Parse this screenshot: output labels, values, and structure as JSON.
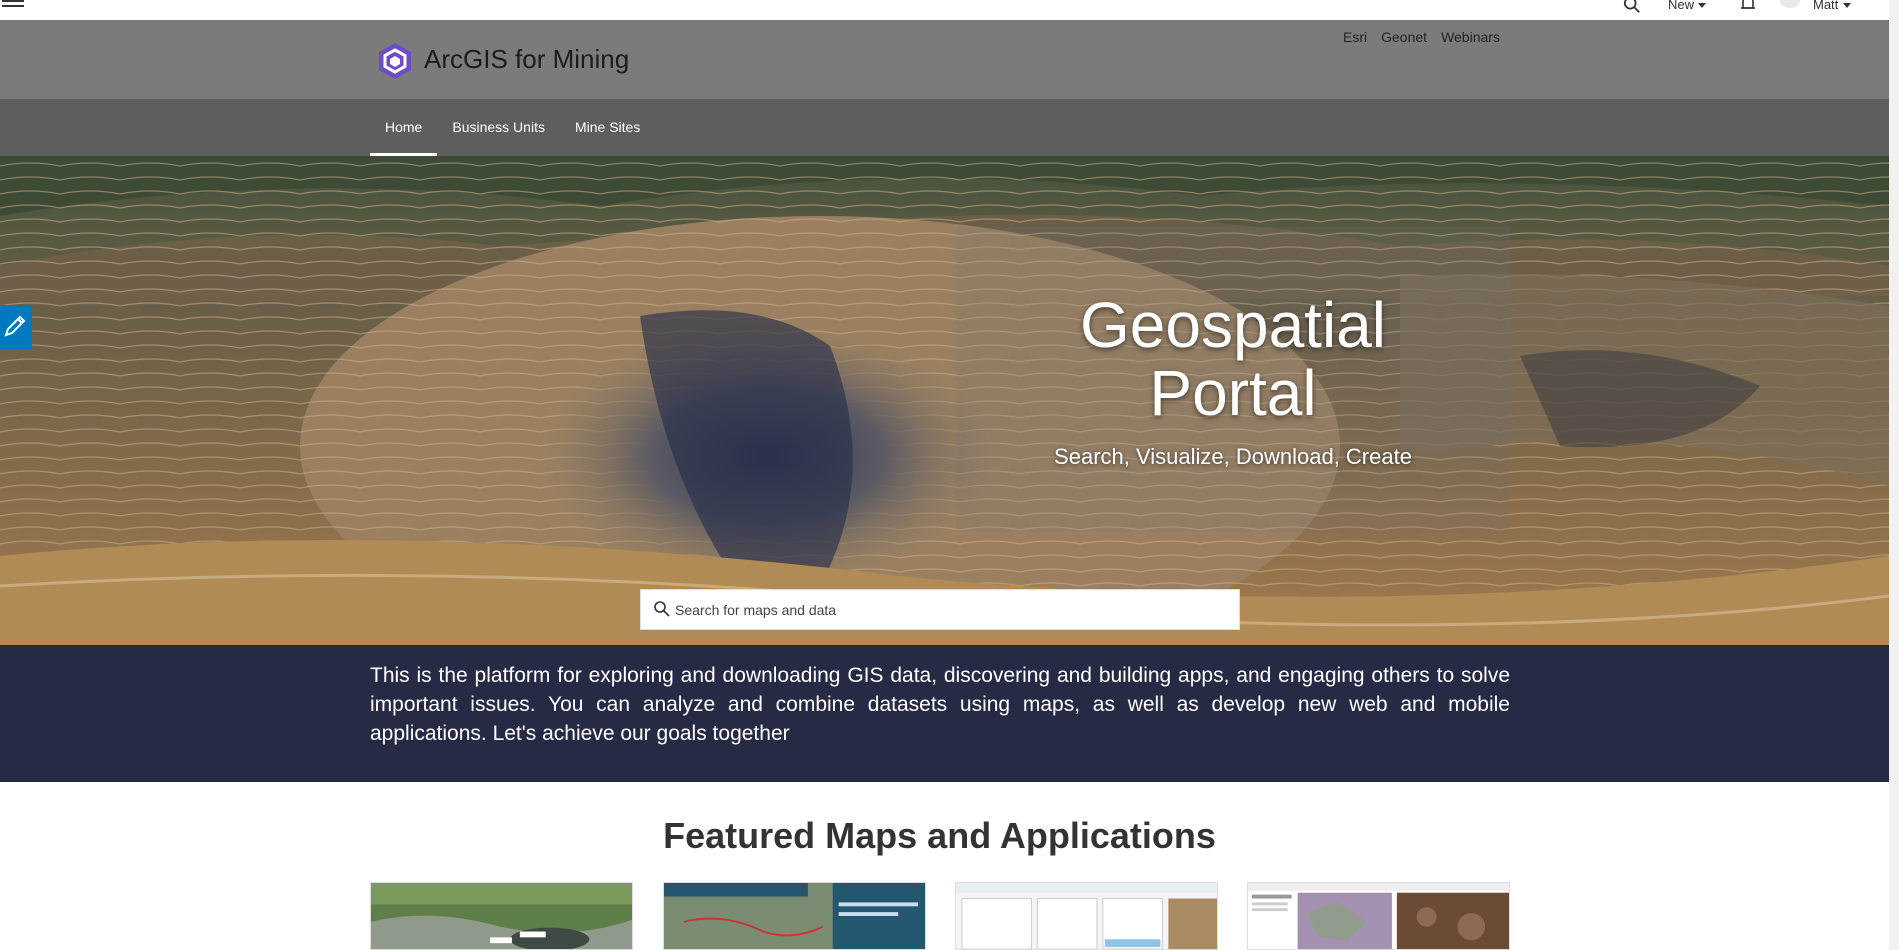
{
  "topbar": {
    "new_label": "New",
    "user_name": "Matt",
    "icons": [
      "menu-icon",
      "search-icon",
      "bell-icon",
      "avatar"
    ]
  },
  "header": {
    "site_title": "ArcGIS for Mining",
    "links": [
      "Esri",
      "Geonet",
      "Webinars"
    ]
  },
  "nav": {
    "items": [
      {
        "label": "Home",
        "active": true
      },
      {
        "label": "Business Units",
        "active": false
      },
      {
        "label": "Mine Sites",
        "active": false
      }
    ]
  },
  "hero": {
    "title_line1": "Geospatial",
    "title_line2": "Portal",
    "subtitle": "Search, Visualize, Download, Create",
    "search_placeholder": "Search for maps and data"
  },
  "description": "This is the platform for exploring and downloading GIS data, discovering and building apps, and engaging others to solve important issues. You can analyze and combine datasets using maps, as well as develop new web and mobile applications. Let's achieve our goals together",
  "featured": {
    "title": "Featured Maps and Applications",
    "cards": [
      "card-aerial-map",
      "card-quarry-viewer",
      "card-inspection-dashboard",
      "card-story-map"
    ]
  },
  "colors": {
    "header_bg": "#7b7b7b",
    "nav_bg": "#5e5e5e",
    "desc_band_bg": "#272a45",
    "accent": "#0079c1",
    "logo_purple": "#6e4cc6"
  }
}
